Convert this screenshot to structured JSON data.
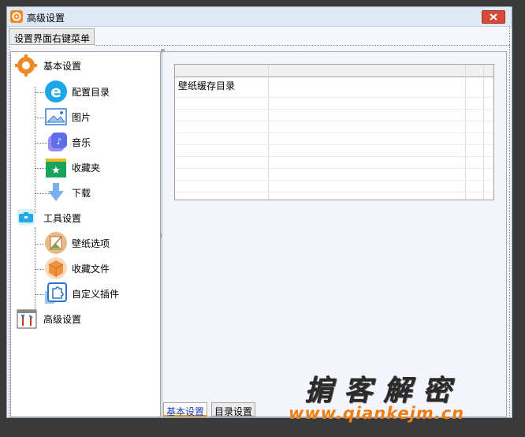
{
  "window": {
    "title": "高级设置"
  },
  "menu": {
    "context_button": "设置界面右键菜单"
  },
  "tree": {
    "groups": [
      {
        "label": "基本设置",
        "icon": "gear-icon",
        "children": [
          {
            "label": "配置目录",
            "icon": "ie-icon"
          },
          {
            "label": "图片",
            "icon": "picture-icon"
          },
          {
            "label": "音乐",
            "icon": "music-icon"
          },
          {
            "label": "收藏夹",
            "icon": "favorites-icon"
          },
          {
            "label": "下载",
            "icon": "download-icon"
          }
        ]
      },
      {
        "label": "工具设置",
        "icon": "toolbox-icon",
        "children": [
          {
            "label": "壁纸选项",
            "icon": "wallpaper-icon"
          },
          {
            "label": "收藏文件",
            "icon": "box-icon"
          },
          {
            "label": "自定义插件",
            "icon": "puzzle-icon"
          }
        ]
      },
      {
        "label": "高级设置",
        "icon": "tools-icon",
        "children": []
      }
    ]
  },
  "grid": {
    "rows": [
      "壁纸缓存目录"
    ]
  },
  "tabs": [
    "基本设置",
    "目录设置"
  ],
  "watermark": {
    "line1": "掮客解密",
    "line2": "www.qiankejm.cn"
  },
  "colors": {
    "accent": "#ee8a23",
    "close": "#d64a3a",
    "tab_active_text": "#1a3cbf"
  }
}
